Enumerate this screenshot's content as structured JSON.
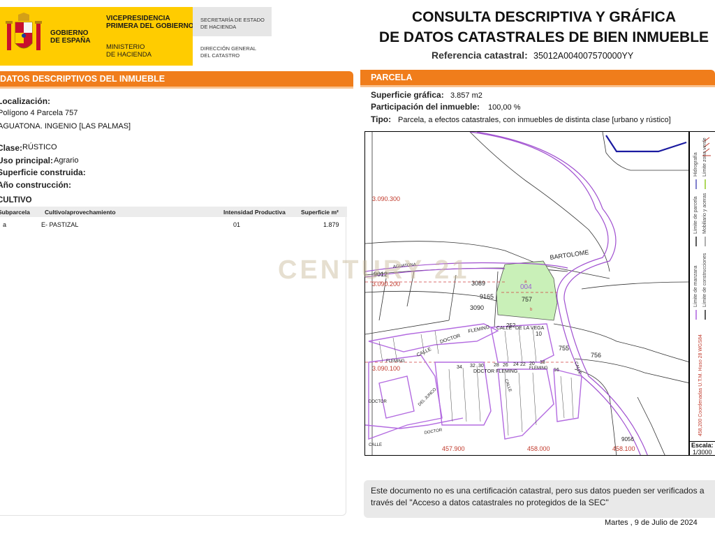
{
  "header": {
    "gov_line1": "GOBIERNO",
    "gov_line2": "DE ESPAÑA",
    "vice_line1": "VICEPRESIDENCIA",
    "vice_line2": "PRIMERA DEL GOBIERNO",
    "minis_line1": "MINISTERIO",
    "minis_line2": "DE HACIENDA",
    "sec_line1": "SECRETARÍA DE ESTADO",
    "sec_line2": "DE HACIENDA",
    "dir_line1": "DIRECCIÓN GENERAL",
    "dir_line2": "DEL CATASTRO",
    "title_line1": "CONSULTA DESCRIPTIVA Y GRÁFICA",
    "title_line2": "DE DATOS CATASTRALES DE BIEN INMUEBLE",
    "ref_label": "Referencia catastral:",
    "ref_value": "35012A004007570000YY"
  },
  "left": {
    "section_title": "DATOS DESCRIPTIVOS DEL INMUEBLE",
    "loc_label": "Localización:",
    "loc_line1": "Polígono 4 Parcela 757",
    "loc_line2": "AGUATONA. INGENIO [LAS PALMAS]",
    "clase_label": "Clase:",
    "clase_value": "RÚSTICO",
    "uso_label": "Uso principal:",
    "uso_value": "Agrario",
    "sup_label": "Superficie construida:",
    "anio_label": "Año construcción:",
    "cultivo_title": "CULTIVO",
    "cultivo_headers": [
      "Subparcela",
      "Cultivo/aprovechamiento",
      "Intensidad Productiva",
      "Superficie m²"
    ],
    "cultivo_rows": [
      {
        "subparcela": "a",
        "cultivo": "E- PASTIZAL",
        "intensidad": "01",
        "superficie": "1.879"
      }
    ]
  },
  "right": {
    "section_title": "PARCELA",
    "sup_label": "Superficie gráfica:",
    "sup_value": "3.857 m2",
    "part_label": "Participación del inmueble:",
    "part_value": "100,00 %",
    "tipo_label": "Tipo:",
    "tipo_value": "Parcela, a efectos catastrales, con inmuebles de distinta clase [urbano y rústico]"
  },
  "map": {
    "coord_labels": [
      "3.090.300",
      "3.090.200",
      "3.090.100",
      "457.900",
      "458.000",
      "458.100"
    ],
    "street_labels": [
      "BARTOLOME",
      "AGUATONA",
      "CALLE",
      "DOCTOR",
      "FLEMING",
      "DOCTOR FLEMING",
      "CALLE",
      "DE LA VEGA",
      "FLEMING",
      "DOCTOR",
      "FLEMING",
      "CALLE",
      "DOCTOR",
      "CALLE",
      "DEL JUNCO",
      "CALLE"
    ],
    "parcel_labels": [
      "9012",
      "3089",
      "9165",
      "757",
      "3090",
      "004",
      "a",
      "b",
      "755",
      "756",
      "10",
      "252",
      "9056",
      "34",
      "32",
      "30",
      "28",
      "26",
      "24",
      "22",
      "20",
      "18",
      "16"
    ],
    "legend_items": [
      "Hidrografía",
      "Límite zona verde",
      "Límite de parcela",
      "Mobiliario y aceras",
      "Límite de manzana",
      "Límite de construcciones"
    ],
    "legend_coords": "458,200 Coordenadas U.T.M. Huso 28 WGS84",
    "escala_label": "Escala:",
    "escala_value": "1/3000",
    "watermark": "CENTURY 21"
  },
  "footer": {
    "note": "Este documento no es una certificación catastral, pero sus datos pueden ser verificados a través del \"Acceso a datos catastrales no protegidos de la SEC\"",
    "date": "Martes , 9 de Julio de 2024"
  },
  "colors": {
    "accent_orange": "#f07d1b",
    "gov_yellow": "#ffcc00",
    "parcel_green": "#c9f0b8",
    "urban_purple": "#b36be0",
    "road_purple": "#a050d0",
    "coord_red": "#c0392b",
    "hydro_blue": "#1a1aa0"
  }
}
